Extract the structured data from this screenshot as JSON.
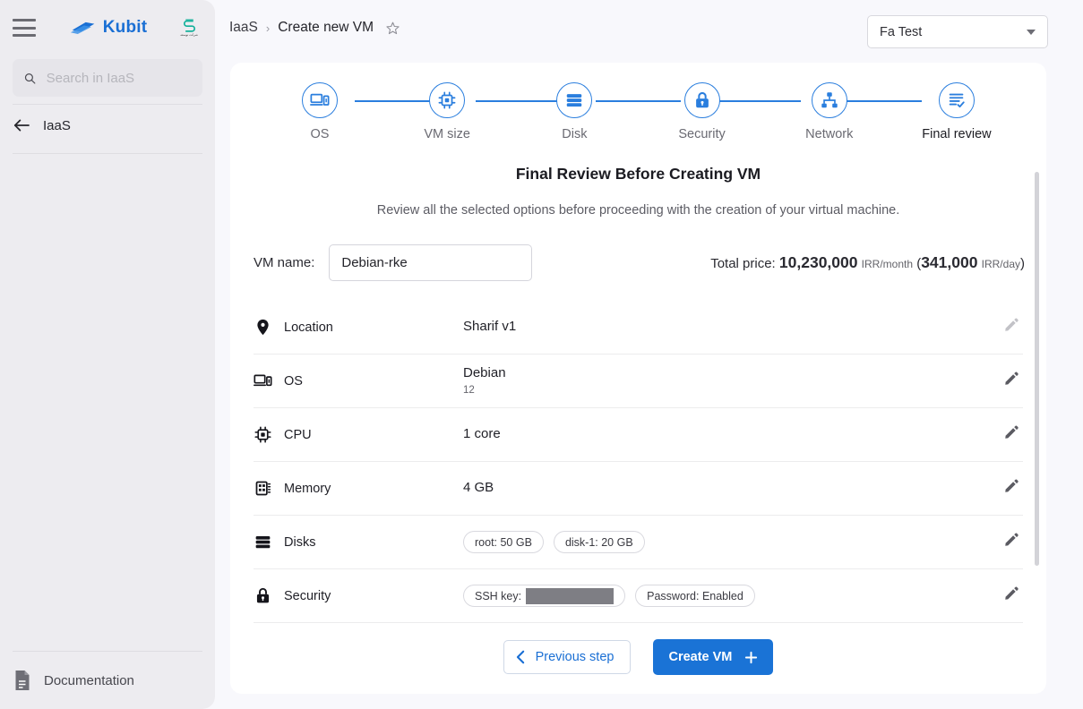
{
  "sidebar": {
    "menu_icon": "hamburger-icon",
    "brand": "Kubit",
    "partner_caption": "شرکت توسعه",
    "search": {
      "placeholder": "Search in IaaS",
      "value": ""
    },
    "nav_item": "IaaS",
    "footer_item": "Documentation"
  },
  "topbar": {
    "breadcrumb": [
      "IaaS",
      "Create new VM"
    ],
    "separator": "›",
    "favorite_icon": "star-icon",
    "account": {
      "label": "Fa Test",
      "icon": "chevron-down-icon"
    }
  },
  "stepper": {
    "steps": [
      {
        "label": "OS",
        "icon": "devices-icon",
        "active": false
      },
      {
        "label": "VM size",
        "icon": "cpu-icon",
        "active": false
      },
      {
        "label": "Disk",
        "icon": "storage-icon",
        "active": false
      },
      {
        "label": "Security",
        "icon": "lock-icon",
        "active": false
      },
      {
        "label": "Network",
        "icon": "network-icon",
        "active": false
      },
      {
        "label": "Final review",
        "icon": "checklist-icon",
        "active": true
      }
    ]
  },
  "main": {
    "title": "Final Review Before Creating VM",
    "subtitle": "Review all the selected options before proceeding with the creation of your virtual machine.",
    "vm_name": {
      "label": "VM name:",
      "value": "Debian-rke",
      "placeholder": ""
    },
    "price": {
      "prefix": "Total price:",
      "monthly_value": "10,230,000",
      "monthly_unit": "IRR/month",
      "open_paren": "(",
      "daily_value": "341,000",
      "daily_unit": "IRR/day",
      "close_paren": ")"
    },
    "rows": [
      {
        "icon": "location-pin-icon",
        "label": "Location",
        "value": "Sharif v1",
        "sub": "",
        "chips": [],
        "edit_icon": "pencil-icon"
      },
      {
        "icon": "devices-icon",
        "label": "OS",
        "value": "Debian",
        "sub": "12",
        "chips": [],
        "edit_icon": "pencil-icon"
      },
      {
        "icon": "cpu-icon",
        "label": "CPU",
        "value": "1 core",
        "sub": "",
        "chips": [],
        "edit_icon": "pencil-icon"
      },
      {
        "icon": "memory-icon",
        "label": "Memory",
        "value": "4 GB",
        "sub": "",
        "chips": [],
        "edit_icon": "pencil-icon"
      },
      {
        "icon": "storage-icon",
        "label": "Disks",
        "value": "",
        "sub": "",
        "chips": [
          "root: 50 GB",
          "disk-1: 20 GB"
        ],
        "edit_icon": "pencil-icon"
      },
      {
        "icon": "lock-icon",
        "label": "Security",
        "value": "",
        "sub": "",
        "chips": [
          "SSH key:",
          "Password: Enabled"
        ],
        "redacted_chip_index": 0,
        "edit_icon": "pencil-icon"
      }
    ],
    "buttons": {
      "previous": {
        "label": "Previous step",
        "icon": "chevron-left-icon"
      },
      "create": {
        "label": "Create VM",
        "icon": "plus-icon"
      }
    }
  },
  "colors": {
    "accent": "#1a73d6",
    "stepper_blue": "#2a7ede",
    "page_bg": "#f8f8fc",
    "sidebar_bg": "#edecf0",
    "card_bg": "#ffffff"
  }
}
